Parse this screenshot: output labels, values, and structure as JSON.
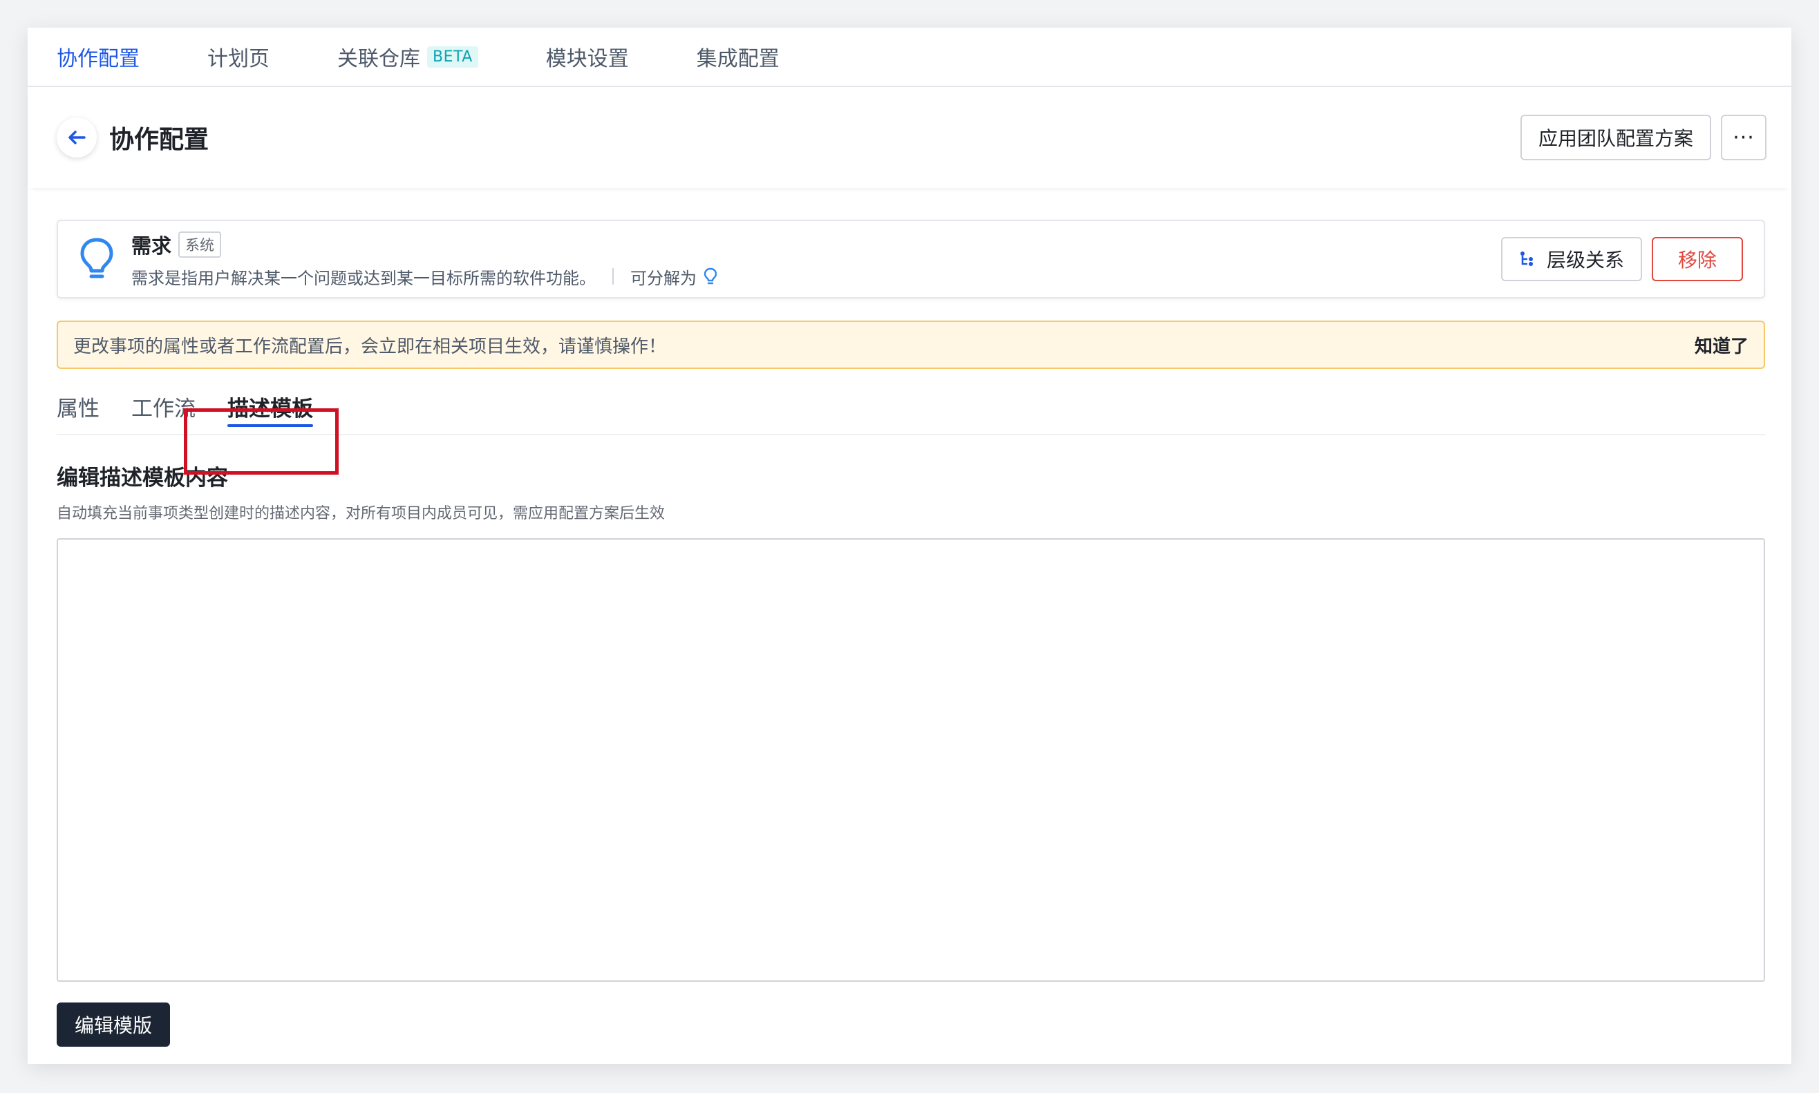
{
  "topnav": {
    "items": [
      {
        "label": "协作配置",
        "active": true
      },
      {
        "label": "计划页",
        "active": false
      },
      {
        "label": "关联仓库",
        "badge": "BETA",
        "active": false
      },
      {
        "label": "模块设置",
        "active": false
      },
      {
        "label": "集成配置",
        "active": false
      }
    ]
  },
  "header": {
    "title": "协作配置",
    "apply_button": "应用团队配置方案",
    "more_button": "···"
  },
  "type_card": {
    "name": "需求",
    "badge": "系统",
    "description": "需求是指用户解决某一个问题或达到某一目标所需的软件功能。",
    "decompose_label": "可分解为",
    "hierarchy_button": "层级关系",
    "remove_button": "移除"
  },
  "alert": {
    "message": "更改事项的属性或者工作流配置后，会立即在相关项目生效，请谨慎操作！",
    "dismiss": "知道了"
  },
  "tabs": [
    {
      "label": "属性",
      "active": false
    },
    {
      "label": "工作流",
      "active": false
    },
    {
      "label": "描述模板",
      "active": true
    }
  ],
  "section": {
    "title": "编辑描述模板内容",
    "subtitle": "自动填充当前事项类型创建时的描述内容，对所有项目内成员可见，需应用配置方案后生效"
  },
  "edit_button": "编辑模版",
  "colors": {
    "accent": "#1d57e6",
    "danger": "#e3483e",
    "highlight": "#d01124",
    "alert_bg": "#fff6e3",
    "alert_border": "#f5c86a",
    "dark_button": "#1b2533"
  }
}
